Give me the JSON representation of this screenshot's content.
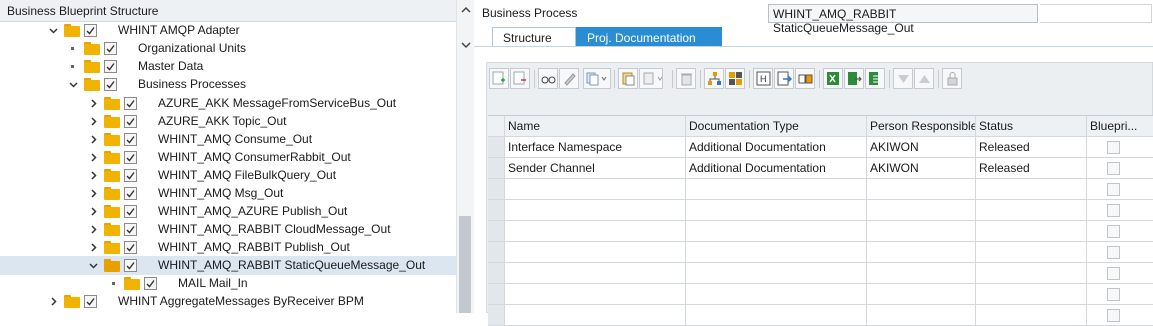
{
  "left_panel": {
    "title": "Business Blueprint Structure",
    "tree": [
      {
        "label": "WHINT AMQP Adapter",
        "expanded": true
      },
      {
        "label": "Organizational Units"
      },
      {
        "label": "Master Data"
      },
      {
        "label": "Business Processes",
        "expanded": true
      },
      {
        "label": "AZURE_AKK MessageFromServiceBus_Out"
      },
      {
        "label": "AZURE_AKK Topic_Out"
      },
      {
        "label": "WHINT_AMQ Consume_Out"
      },
      {
        "label": "WHINT_AMQ ConsumerRabbit_Out"
      },
      {
        "label": "WHINT_AMQ FileBulkQuery_Out"
      },
      {
        "label": "WHINT_AMQ Msg_Out"
      },
      {
        "label": "WHINT_AMQ_AZURE Publish_Out"
      },
      {
        "label": "WHINT_AMQ_RABBIT CloudMessage_Out"
      },
      {
        "label": "WHINT_AMQ_RABBIT Publish_Out"
      },
      {
        "label": "WHINT_AMQ_RABBIT StaticQueueMessage_Out",
        "selected": true,
        "expanded": true
      },
      {
        "label": "MAIL Mail_In"
      },
      {
        "label": "WHINT AggregateMessages ByReceiver BPM"
      }
    ]
  },
  "right_panel": {
    "business_process_label": "Business Process",
    "business_process_value": "WHINT_AMQ_RABBIT StaticQueueMessage_Out",
    "tabs": [
      {
        "label": "Structure",
        "active": false
      },
      {
        "label": "Proj. Documentation",
        "active": true
      }
    ],
    "toolbar_icons": [
      "insert-row-icon",
      "delete-row-icon",
      "display-icon",
      "edit-icon",
      "copy-icon",
      "paste-icon",
      "copy-doc-icon",
      "delete-icon",
      "hierarchy-icon",
      "grid-icon",
      "header-icon",
      "export-icon",
      "transfer-icon",
      "excel-icon",
      "excel-export-icon",
      "excel-import-icon",
      "down-icon",
      "up-icon",
      "lock-icon"
    ],
    "table": {
      "columns": [
        "Name",
        "Documentation Type",
        "Person Responsible",
        "Status",
        "Bluepri..."
      ],
      "rows": [
        {
          "name": "Interface Namespace",
          "doc_type": "Additional Documentation",
          "person": "AKIWON",
          "status": "Released",
          "blueprint": false
        },
        {
          "name": "Sender Channel",
          "doc_type": "Additional Documentation",
          "person": "AKIWON",
          "status": "Released",
          "blueprint": false
        },
        {
          "name": "",
          "doc_type": "",
          "person": "",
          "status": "",
          "blueprint": false
        },
        {
          "name": "",
          "doc_type": "",
          "person": "",
          "status": "",
          "blueprint": false
        },
        {
          "name": "",
          "doc_type": "",
          "person": "",
          "status": "",
          "blueprint": false
        },
        {
          "name": "",
          "doc_type": "",
          "person": "",
          "status": "",
          "blueprint": false
        },
        {
          "name": "",
          "doc_type": "",
          "person": "",
          "status": "",
          "blueprint": false
        },
        {
          "name": "",
          "doc_type": "",
          "person": "",
          "status": "",
          "blueprint": false
        },
        {
          "name": "",
          "doc_type": "",
          "person": "",
          "status": "",
          "blueprint": false
        }
      ]
    }
  },
  "colors": {
    "tab_active": "#2a8dd4",
    "selection": "#dbe6f1",
    "folder": "#f0b400"
  }
}
